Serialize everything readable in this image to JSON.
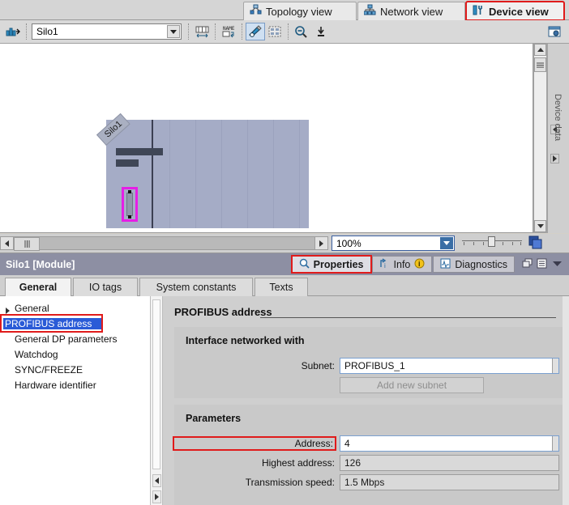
{
  "view_tabs": [
    {
      "label": "Topology view",
      "icon": "topology-icon",
      "active": false
    },
    {
      "label": "Network view",
      "icon": "network-icon",
      "active": false
    },
    {
      "label": "Device view",
      "icon": "device-icon",
      "active": true,
      "highlighted": true
    }
  ],
  "toolbar": {
    "network_icon": "network-nodes-icon",
    "device_selector": {
      "value": "Silo1",
      "placeholder": "Select device"
    },
    "buttons": [
      {
        "name": "address-overview-button",
        "icon": "address-overview-icon"
      },
      {
        "name": "module-name-button",
        "icon": "module-name-icon"
      },
      {
        "name": "pen-tool-button",
        "icon": "pen-tool-icon",
        "pressed": true
      },
      {
        "name": "grid-button",
        "icon": "grid-icon"
      },
      {
        "name": "zoom-out-button",
        "icon": "zoom-out-icon"
      },
      {
        "name": "fit-to-window-button",
        "icon": "fit-arrow-icon"
      }
    ],
    "options_button": {
      "name": "window-options-button",
      "icon": "window-options-icon"
    }
  },
  "canvas": {
    "device_label": "Silo1",
    "rack_color": "#a5acc6",
    "selection_color": "#e61ee6",
    "selected_module": "module-slot-selected",
    "thumbnail": "module-photo-thumbnail"
  },
  "device_data_strip": {
    "label": "Device data"
  },
  "zoom_bar": {
    "zoom_value": "100%",
    "scroll_left_icon": "scroll-left-icon",
    "scroll_right_icon": "scroll-right-icon",
    "slider_position": "center",
    "overview_button": "overview-icon"
  },
  "properties_header": {
    "title": "Silo1 [Module]",
    "tabs": [
      {
        "label": "Properties",
        "icon": "properties-icon",
        "active": true,
        "highlighted": true
      },
      {
        "label": "Info",
        "icon": "info-icon",
        "badge": "info-badge-icon",
        "active": false
      },
      {
        "label": "Diagnostics",
        "icon": "diagnostics-icon",
        "active": false
      }
    ],
    "window_buttons": [
      {
        "name": "restore-button",
        "icon": "restore-icon"
      },
      {
        "name": "list-button",
        "icon": "list-icon"
      },
      {
        "name": "collapse-button",
        "icon": "chevron-down-icon"
      }
    ]
  },
  "detail_tabs": [
    {
      "label": "General",
      "active": true
    },
    {
      "label": "IO tags",
      "active": false
    },
    {
      "label": "System constants",
      "active": false
    },
    {
      "label": "Texts",
      "active": false
    }
  ],
  "nav_items": [
    {
      "label": "General",
      "expandable": true,
      "selected": false
    },
    {
      "label": "PROFIBUS address",
      "expandable": false,
      "selected": true,
      "highlighted": true
    },
    {
      "label": "General DP parameters",
      "expandable": false,
      "selected": false
    },
    {
      "label": "Watchdog",
      "expandable": false,
      "selected": false
    },
    {
      "label": "SYNC/FREEZE",
      "expandable": false,
      "selected": false
    },
    {
      "label": "Hardware identifier",
      "expandable": false,
      "selected": false
    }
  ],
  "content": {
    "section_title": "PROFIBUS address",
    "groups": [
      {
        "title": "Interface networked with",
        "fields": [
          {
            "label": "Subnet:",
            "value": "PROFIBUS_1",
            "type": "combo",
            "readonly": false
          }
        ],
        "button": {
          "label": "Add new subnet",
          "disabled": true
        }
      },
      {
        "title": "Parameters",
        "fields": [
          {
            "label": "Address:",
            "value": "4",
            "type": "combo",
            "readonly": false,
            "highlighted": true
          },
          {
            "label": "Highest address:",
            "value": "126",
            "type": "text",
            "readonly": true
          },
          {
            "label": "Transmission speed:",
            "value": "1.5 Mbps",
            "type": "text",
            "readonly": true
          }
        ]
      }
    ]
  },
  "colors": {
    "highlight_red": "#e01b1b",
    "selection_blue": "#2a5bd7",
    "selection_magenta": "#e61ee6",
    "header_purple": "#8d8fa3",
    "accent_blue": "#3a6ea5"
  }
}
